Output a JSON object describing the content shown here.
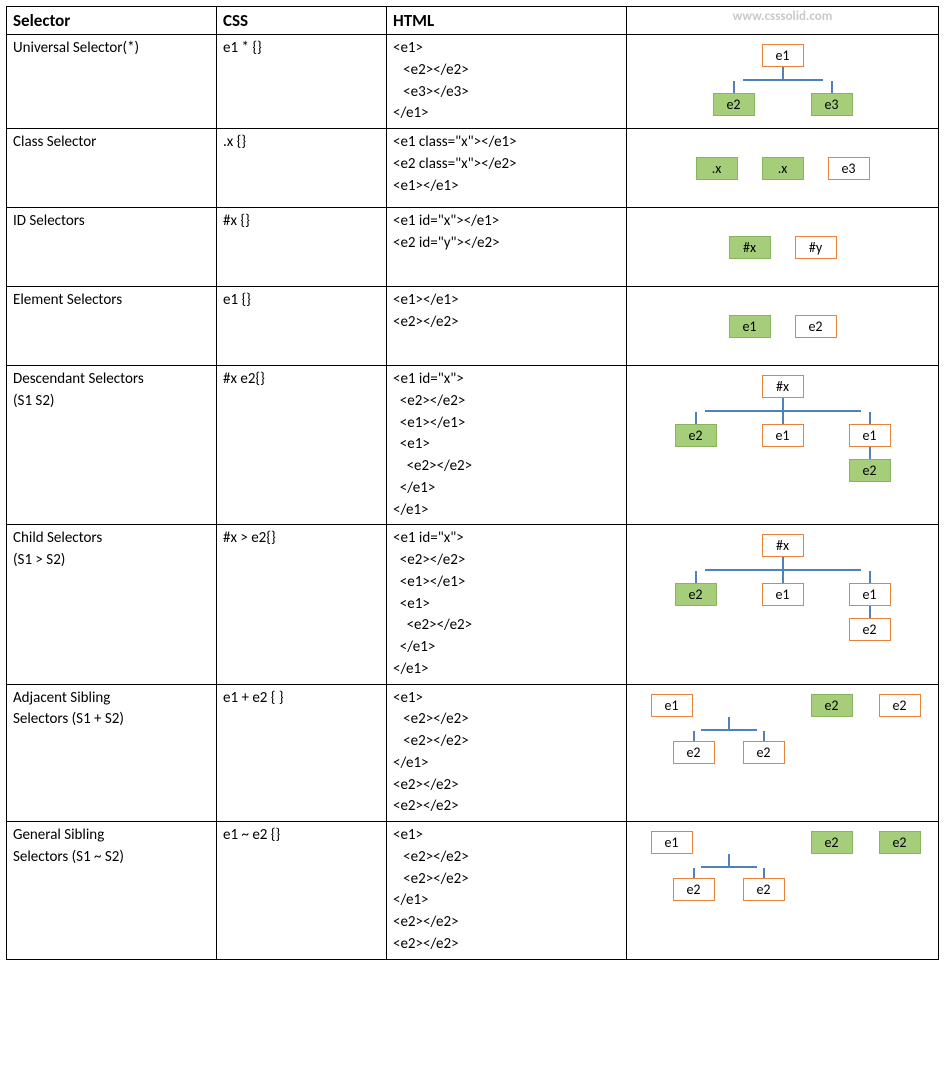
{
  "watermark": "www.csssolid.com",
  "headers": {
    "selector": "Selector",
    "css": "CSS",
    "html": "HTML"
  },
  "rows": [
    {
      "selector": "Universal Selector(*)",
      "css": "e1 * {}",
      "html": "<e1>\n   <e2></e2>\n   <e3></e3>\n</e1>",
      "diagram": {
        "type": "tree",
        "root": {
          "label": "e1",
          "sel": false
        },
        "children": [
          {
            "label": "e2",
            "sel": true
          },
          {
            "label": "e3",
            "sel": true
          }
        ]
      }
    },
    {
      "selector": "Class Selector",
      "css": ".x {}",
      "html": "<e1 class=\"x\"></e1>\n<e2 class=\"x\"></e2>\n<e1></e1>",
      "diagram": {
        "type": "row",
        "nodes": [
          {
            "label": ".x",
            "sel": true
          },
          {
            "label": ".x",
            "sel": true
          },
          {
            "label": "e3",
            "sel": false
          }
        ]
      }
    },
    {
      "selector": "ID Selectors",
      "css": "#x {}",
      "html": "<e1 id=\"x\"></e1>\n<e2 id=\"y\"></e2>",
      "diagram": {
        "type": "row",
        "nodes": [
          {
            "label": "#x",
            "sel": true
          },
          {
            "label": "#y",
            "sel": false
          }
        ]
      }
    },
    {
      "selector": "Element Selectors",
      "css": "e1 {}",
      "html": "<e1></e1>\n<e2></e2>",
      "diagram": {
        "type": "row",
        "nodes": [
          {
            "label": "e1",
            "sel": true
          },
          {
            "label": "e2",
            "sel": false
          }
        ]
      }
    },
    {
      "selector": "Descendant Selectors\n(S1 S2)",
      "css": "#x e2{}",
      "html": "<e1 id=\"x\">\n  <e2></e2>\n  <e1></e1>\n  <e1>\n    <e2></e2>\n  </e1>\n</e1>",
      "diagram": {
        "type": "tree3",
        "root": {
          "label": "#x",
          "sel": false
        },
        "children": [
          {
            "label": "e2",
            "sel": true
          },
          {
            "label": "e1",
            "sel": false
          },
          {
            "label": "e1",
            "sel": false,
            "child": {
              "label": "e2",
              "sel": true
            }
          }
        ]
      }
    },
    {
      "selector": "Child Selectors\n(S1 > S2)",
      "css": "#x > e2{}",
      "html": "<e1 id=\"x\">\n  <e2></e2>\n  <e1></e1>\n  <e1>\n    <e2></e2>\n  </e1>\n</e1>",
      "diagram": {
        "type": "tree3",
        "root": {
          "label": "#x",
          "sel": false
        },
        "children": [
          {
            "label": "e2",
            "sel": true
          },
          {
            "label": "e1",
            "sel": false
          },
          {
            "label": "e1",
            "sel": false,
            "child": {
              "label": "e2",
              "sel": false
            }
          }
        ]
      }
    },
    {
      "selector": "Adjacent Sibling\nSelectors (S1 + S2)",
      "css": "e1 + e2 { }",
      "html": "<e1>\n   <e2></e2>\n   <e2></e2>\n</e1>\n<e2></e2>\n<e2></e2>",
      "diagram": {
        "type": "sibling",
        "root": {
          "label": "e1",
          "sel": false
        },
        "rootChildren": [
          {
            "label": "e2",
            "sel": false
          },
          {
            "label": "e2",
            "sel": false
          }
        ],
        "siblings": [
          {
            "label": "e2",
            "sel": true
          },
          {
            "label": "e2",
            "sel": false
          }
        ]
      }
    },
    {
      "selector": "General Sibling\nSelectors (S1 ~ S2)",
      "css": "e1 ~ e2 {}",
      "html": "<e1>\n   <e2></e2>\n   <e2></e2>\n</e1>\n<e2></e2>\n<e2></e2>",
      "diagram": {
        "type": "sibling",
        "root": {
          "label": "e1",
          "sel": false
        },
        "rootChildren": [
          {
            "label": "e2",
            "sel": false
          },
          {
            "label": "e2",
            "sel": false
          }
        ],
        "siblings": [
          {
            "label": "e2",
            "sel": true
          },
          {
            "label": "e2",
            "sel": true
          }
        ]
      }
    }
  ]
}
